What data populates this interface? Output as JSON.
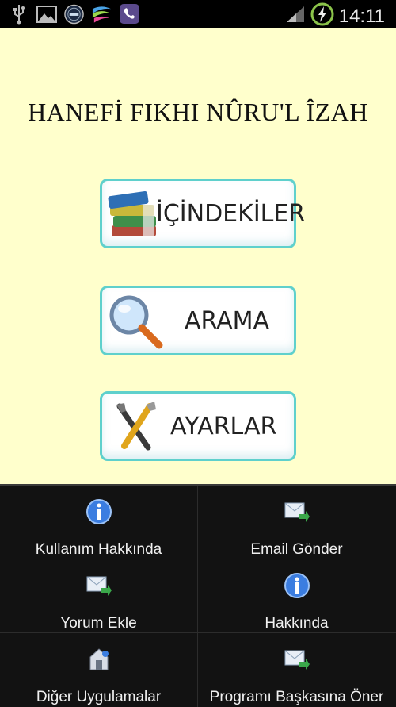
{
  "status_bar": {
    "time": "14:11",
    "icons": [
      "usb-icon",
      "image-icon",
      "app-badge-icon",
      "swiftkey-icon",
      "viber-icon"
    ],
    "signal_icon": "signal-icon",
    "battery_icon": "battery-charging-icon"
  },
  "app": {
    "title": "HANEFİ FIKHI NÛRU'L ÎZAH",
    "background": "#ffffcc",
    "accent": "#5fd0cc"
  },
  "buttons": [
    {
      "label": "İÇİNDEKİLER",
      "icon": "books-icon"
    },
    {
      "label": "ARAMA",
      "icon": "magnifier-icon"
    },
    {
      "label": "AYARLAR",
      "icon": "tools-icon"
    }
  ],
  "menu": {
    "items": [
      {
        "label": "Kullanım Hakkında",
        "icon": "info-icon"
      },
      {
        "label": "Email Gönder",
        "icon": "mail-send-icon"
      },
      {
        "label": "Yorum Ekle",
        "icon": "mail-send-icon"
      },
      {
        "label": "Hakkında",
        "icon": "info-icon"
      },
      {
        "label": "Diğer Uygulamalar",
        "icon": "app-store-icon"
      },
      {
        "label": "Programı Başkasına Öner",
        "icon": "mail-send-icon"
      }
    ]
  }
}
